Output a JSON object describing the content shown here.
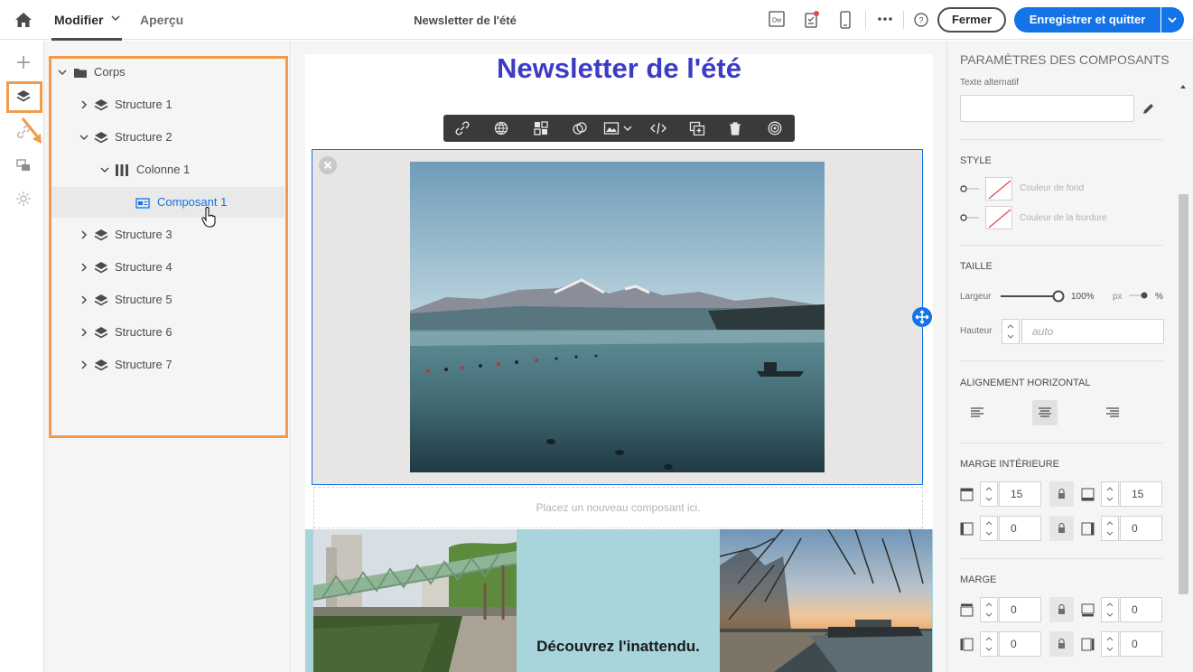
{
  "topbar": {
    "tab_modifier": "Modifier",
    "tab_apercu": "Aperçu",
    "document_title": "Newsletter de l'été",
    "dreamweaver_label": "Dw",
    "fermer_label": "Fermer",
    "save_label": "Enregistrer et quitter"
  },
  "tree": {
    "root": "Corps",
    "structure_1": "Structure 1",
    "structure_2": "Structure 2",
    "colonne_1": "Colonne 1",
    "composant_1": "Composant 1",
    "structure_3": "Structure 3",
    "structure_4": "Structure 4",
    "structure_5": "Structure 5",
    "structure_6": "Structure 6",
    "structure_7": "Structure 7"
  },
  "canvas": {
    "newsletter_title": "Newsletter de l'été",
    "dropzone": "Placez un nouveau composant ici.",
    "discover_text": "Découvrez l'inattendu."
  },
  "panel": {
    "title": "PARAMÈTRES DES COMPOSANTS",
    "alt_text_label": "Texte alternatif",
    "alt_text_value": "",
    "style_head": "STYLE",
    "bg_color_label": "Couleur de fond",
    "border_color_label": "Couleur de la bordure",
    "size_head": "TAILLE",
    "width_label": "Largeur",
    "width_value": "100%",
    "width_fraction": 1.0,
    "unit_px": "px",
    "unit_percent": "%",
    "height_label": "Hauteur",
    "height_placeholder": "auto",
    "align_head": "ALIGNEMENT HORIZONTAL",
    "align_selected": "center",
    "padding_head": "MARGE INTÉRIEURE",
    "padding_top": "15",
    "padding_bottom": "15",
    "padding_left": "0",
    "padding_right": "0",
    "margin_head": "MARGE",
    "margin_top": "0",
    "margin_bottom": "0",
    "margin_left": "0",
    "margin_right": "0"
  },
  "colors": {
    "accent": "#1473e6",
    "highlight": "#f29b4b",
    "title_blue": "#3c3cc7",
    "teal_block": "#a8d4dc"
  }
}
